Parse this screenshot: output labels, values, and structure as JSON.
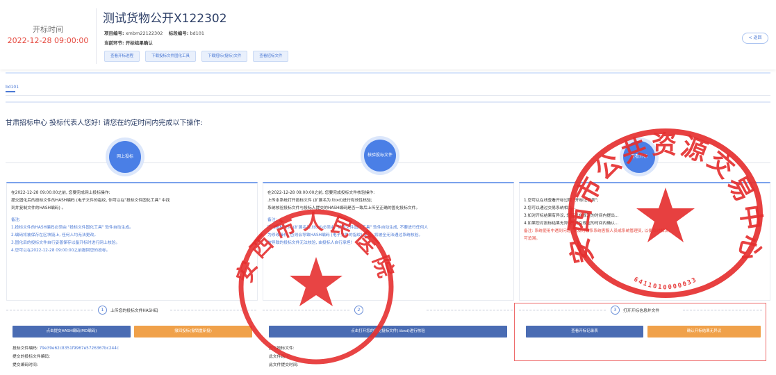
{
  "header": {
    "time_label": "开标时间",
    "time_value": "2022-12-28 09:00:00",
    "title": "测试货物公开X122302",
    "project_no_label": "项目编号:",
    "project_no": "xmbm22122302",
    "bid_no_label": "标段编号:",
    "bid_no": "bd101",
    "current_step_label": "当前环节:",
    "current_step": "开标结果确认",
    "buttons": [
      "查看开标进程",
      "下载投标文件固化工具",
      "下载招标(投标)文件",
      "查看招标文件"
    ],
    "back": "< 返回"
  },
  "tab": "bd101",
  "greeting": "甘肃招标中心 投标代表人您好! 请您在约定时间内完成以下操作:",
  "steps": [
    {
      "circle": "网上投标",
      "step_no": "1",
      "step_title": "上传您的投标文件HASH码"
    },
    {
      "circle": "核验投标文件",
      "step_no": "2",
      "step_title": ""
    },
    {
      "circle": "查看开标",
      "step_no": "3",
      "step_title": "打开开标信息并文件"
    }
  ],
  "card1": {
    "l1": "在2022-12-28 09:00:00之前, 您要完成网上投标操作:",
    "l2": "提交固化后的投标文件的HASH编码 (电子文件的指纹, 你可以在\"投标文件固化工具\" 中找",
    "l3": "到并复制文件的HASH编码) 。",
    "note": "备注:",
    "n1": "1.投标文件的HASH编码必须由 \"投标文件固化工具\" 软件自动生成。",
    "n2": "2.编码将被保存在区块链上, 任何人均无法更改。",
    "n3": "3.固化后的投标文件自行妥善保存以备开标时进行网上核验。",
    "n4": "4.您可以在2022-12-28 09:00:00之前撤回您的投标。",
    "btn_left": "点击提交HASH编码(MD编码)",
    "btn_right": "撤回投标(撤销重新投)",
    "hash_label": "投标文件编码:",
    "hash_value": "79e39e62c8351f9967e5726367bc244c",
    "submit_code_label": "提交的投标文件编码:",
    "submit_time_label": "提交编码时间:"
  },
  "card2": {
    "l1": "在2022-12-28 09:00:00之前, 您要完成投标文件核验操作:",
    "l2": "上传本系统打开投标文件 (扩展名为.tbxd)进行有效性核验;",
    "l3": "系统核验投标文件与投标人提交的HASH编码是否一致后上传至正确的固化投标文件。",
    "note": "备注:",
    "n1": "固化投标文件 (扩展名为.tbxd)必须由 \"投标文件固化工具\" 软件自动生成, 不要进行任何人",
    "n2": "为修改操作, 否则会导致HASH编码 (电子文件的指纹) 变化, 将被全无法通过系统核验。",
    "n3": "被导致的投标文件无法核验, 由投标人自行承担!",
    "btn": "点击打开您的固化投标文件(.tbxd)进行核验",
    "i1": "固化投标文件:",
    "i2": "此文件路径:",
    "i3": "此文件提交时间:"
  },
  "card3": {
    "l1": "1.您可以在线查看开标过程 \"开标记录表\";",
    "l2": "2.您可以通过交易系统相关...",
    "l3": "3.如对开标结果有异议, 您可以在规定的时间内提出...",
    "l4": "4.如果您对投标结果无异议, 请在规定的时间内确认...",
    "red": "备注: 系统使用中遇到问题, 请及时联系系统客服人员或系统管理员, 以便及时解决。",
    "red2": "可追溯。",
    "btn_left": "查看开标记录表",
    "btn_right": "确认开标结果无异议"
  },
  "seals": {
    "s1_text": "安西市人民医院",
    "s2_text": "安西市公共资源交易中心",
    "s2_code": "6411010000033",
    "color": "#e53030"
  }
}
